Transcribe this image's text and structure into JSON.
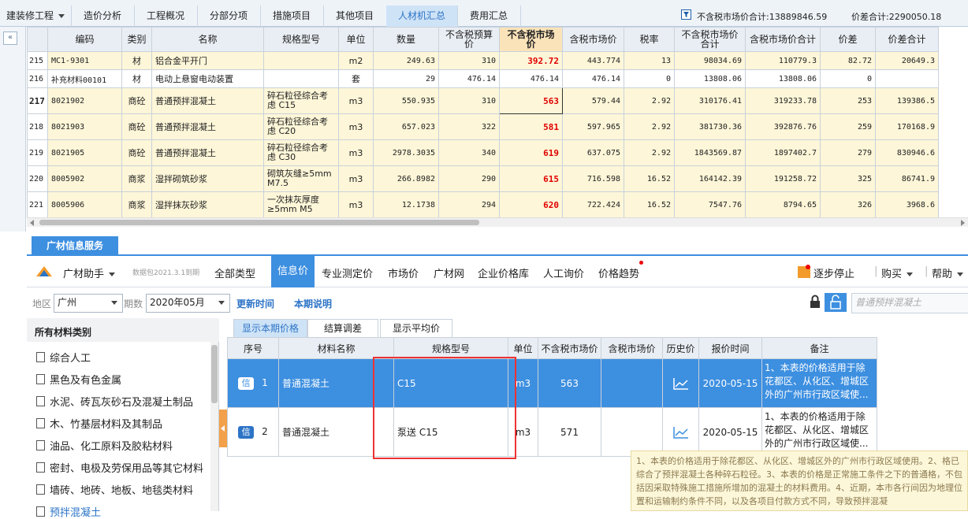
{
  "top_tabs": [
    {
      "label": "建装修工程",
      "dropdown": true,
      "active": false
    },
    {
      "label": "造价分析",
      "active": false
    },
    {
      "label": "工程概况",
      "active": false
    },
    {
      "label": "分部分项",
      "active": false
    },
    {
      "label": "措施项目",
      "active": false
    },
    {
      "label": "其他项目",
      "active": false
    },
    {
      "label": "人材机汇总",
      "active": true
    },
    {
      "label": "费用汇总",
      "active": false
    }
  ],
  "summary": {
    "untaxed_total": "不含税市场价合计:13889846.59",
    "diff_total": "价差合计:2290050.18"
  },
  "grid": {
    "headers": [
      "编码",
      "类别",
      "名称",
      "规格型号",
      "单位",
      "数量",
      "不含税预算价",
      "不含税市场价",
      "含税市场价",
      "税率",
      "不含税市场价合计",
      "含税市场价合计",
      "价差",
      "价差合计"
    ],
    "rows": [
      {
        "idx": "215",
        "code": "MC1-9301",
        "type": "材",
        "name": "铝合金平开门",
        "spec": "",
        "unit": "m2",
        "qty": "249.63",
        "budget": "310",
        "market": "392.72",
        "tax_market": "443.774",
        "rate": "13",
        "untaxed_sum": "98034.69",
        "taxed_sum": "110779.3",
        "diff": "82.72",
        "diff_sum": "20649.3"
      },
      {
        "idx": "216",
        "code": "补充材料00101",
        "type": "材",
        "name": "电动上悬窗电动装置",
        "spec": "",
        "unit": "套",
        "qty": "29",
        "budget": "476.14",
        "market": "476.14",
        "tax_market": "476.14",
        "rate": "0",
        "untaxed_sum": "13808.06",
        "taxed_sum": "13808.06",
        "diff": "0",
        "diff_sum": ""
      },
      {
        "idx": "217",
        "code": "8021902",
        "type": "商砼",
        "name": "普通预拌混凝土",
        "spec": "碎石粒径综合考虑 C15",
        "unit": "m3",
        "qty": "550.935",
        "budget": "310",
        "market": "563",
        "tax_market": "579.44",
        "rate": "2.92",
        "untaxed_sum": "310176.41",
        "taxed_sum": "319233.78",
        "diff": "253",
        "diff_sum": "139386.5"
      },
      {
        "idx": "218",
        "code": "8021903",
        "type": "商砼",
        "name": "普通预拌混凝土",
        "spec": "碎石粒径综合考虑 C20",
        "unit": "m3",
        "qty": "657.023",
        "budget": "322",
        "market": "581",
        "tax_market": "597.965",
        "rate": "2.92",
        "untaxed_sum": "381730.36",
        "taxed_sum": "392876.76",
        "diff": "259",
        "diff_sum": "170168.9"
      },
      {
        "idx": "219",
        "code": "8021905",
        "type": "商砼",
        "name": "普通预拌混凝土",
        "spec": "碎石粒径综合考虑 C30",
        "unit": "m3",
        "qty": "2978.3035",
        "budget": "340",
        "market": "619",
        "tax_market": "637.075",
        "rate": "2.92",
        "untaxed_sum": "1843569.87",
        "taxed_sum": "1897402.7",
        "diff": "279",
        "diff_sum": "830946.6"
      },
      {
        "idx": "220",
        "code": "8005902",
        "type": "商浆",
        "name": "湿拌砌筑砂浆",
        "spec": "砌筑灰缝≥5mm M7.5",
        "unit": "m3",
        "qty": "266.8982",
        "budget": "290",
        "market": "615",
        "tax_market": "716.598",
        "rate": "16.52",
        "untaxed_sum": "164142.39",
        "taxed_sum": "191258.72",
        "diff": "325",
        "diff_sum": "86741.9"
      },
      {
        "idx": "221",
        "code": "8005906",
        "type": "商浆",
        "name": "湿拌抹灰砂浆",
        "spec": "一次抹灰厚度≥5mm M5",
        "unit": "m3",
        "qty": "12.1738",
        "budget": "294",
        "market": "620",
        "tax_market": "722.424",
        "rate": "16.52",
        "untaxed_sum": "7547.76",
        "taxed_sum": "8794.65",
        "diff": "326",
        "diff_sum": "3968.6"
      }
    ]
  },
  "service_tab": "广材信息服务",
  "assistant": {
    "title": "广材助手",
    "data_pack": "数据包2021.3.1到期",
    "tabs": [
      "全部类型",
      "信息价",
      "专业测定价",
      "市场价",
      "广材网",
      "企业价格库",
      "人工询价",
      "价格趋势"
    ],
    "active_tab": "信息价",
    "right_actions": [
      "逐步停止",
      "购买",
      "帮助"
    ]
  },
  "filters": {
    "region_label": "地区",
    "region_value": "广州",
    "period_label": "期数",
    "period_value": "2020年05月",
    "update_time": "更新时间",
    "period_note": "本期说明",
    "search_placeholder": "普通预拌混凝土"
  },
  "categories": {
    "title": "所有材料类别",
    "items": [
      "综合人工",
      "黑色及有色金属",
      "水泥、砖瓦灰砂石及混凝土制品",
      "木、竹基层材料及其制品",
      "油品、化工原料及胶粘材料",
      "密封、电极及劳保用品等其它材料",
      "墙砖、地砖、地板、地毯类材料",
      "预拌混凝土"
    ]
  },
  "subtabs": [
    "显示本期价格",
    "结算调差",
    "显示平均价"
  ],
  "price_table": {
    "headers": [
      "序号",
      "材料名称",
      "规格型号",
      "单位",
      "不含税市场价",
      "含税市场价",
      "历史价",
      "报价时间",
      "备注"
    ],
    "badge": "信",
    "rows": [
      {
        "seq": "1",
        "name": "普通混凝土",
        "spec": "C15",
        "unit": "m3",
        "untaxed": "563",
        "taxed": "",
        "date": "2020-05-15",
        "note": "1、本表的价格适用于除花都区、从化区、增城区外的广州市行政区域使..."
      },
      {
        "seq": "2",
        "name": "普通混凝土",
        "spec": "泵送 C15",
        "unit": "m3",
        "untaxed": "571",
        "taxed": "",
        "date": "2020-05-15",
        "note": "1、本表的价格适用于除花都区、从化区、增城区外的广州市行政区域使..."
      }
    ]
  },
  "tooltip": "1、本表的价格适用于除花都区、从化区、增城区外的广州市行政区域使用。2、格已综合了预拌混凝土各种碎石粒径。3、本表的价格是正常施工条件之下的普通格，不包括因采取特殊施工措施所增加的混凝土的材料费用。4、近期，本市各行间因为地理位置和运输制约条件不同，以及各项目付款方式不同，导致预拌混凝",
  "colors": {
    "accent": "#3d8fe0",
    "price_red": "#e00000",
    "row_yellow": "#fdf6d8",
    "highlight_box": "#e33333"
  }
}
